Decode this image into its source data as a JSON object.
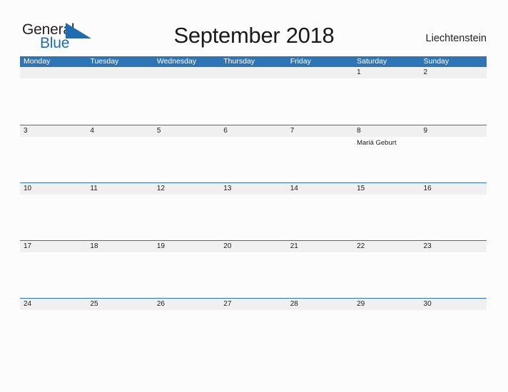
{
  "logo": {
    "word_one": "General",
    "word_two": "Blue",
    "triangle_icon": "blue-triangle-icon",
    "black_color": "#231f20",
    "blue_color": "#1f6cb0"
  },
  "header": {
    "title": "September 2018",
    "country": "Liechtenstein"
  },
  "theme": {
    "header_bar_color": "#2e75b6",
    "date_band_color": "#f0f0f0",
    "rule_color": "#2e75b6",
    "page_background": "#fcfcfc",
    "text_color": "#1a1a1a"
  },
  "calendar": {
    "month": "September",
    "year": "2018",
    "weekdays": [
      "Monday",
      "Tuesday",
      "Wednesday",
      "Thursday",
      "Friday",
      "Saturday",
      "Sunday"
    ],
    "weeks": [
      {
        "has_rule": false,
        "days": [
          {
            "date": "",
            "event": ""
          },
          {
            "date": "",
            "event": ""
          },
          {
            "date": "",
            "event": ""
          },
          {
            "date": "",
            "event": ""
          },
          {
            "date": "",
            "event": ""
          },
          {
            "date": "1",
            "event": ""
          },
          {
            "date": "2",
            "event": ""
          }
        ]
      },
      {
        "has_rule": true,
        "days": [
          {
            "date": "3",
            "event": ""
          },
          {
            "date": "4",
            "event": ""
          },
          {
            "date": "5",
            "event": ""
          },
          {
            "date": "6",
            "event": ""
          },
          {
            "date": "7",
            "event": ""
          },
          {
            "date": "8",
            "event": "Mariä Geburt"
          },
          {
            "date": "9",
            "event": ""
          }
        ]
      },
      {
        "has_rule": true,
        "days": [
          {
            "date": "10",
            "event": ""
          },
          {
            "date": "11",
            "event": ""
          },
          {
            "date": "12",
            "event": ""
          },
          {
            "date": "13",
            "event": ""
          },
          {
            "date": "14",
            "event": ""
          },
          {
            "date": "15",
            "event": ""
          },
          {
            "date": "16",
            "event": ""
          }
        ]
      },
      {
        "has_rule": true,
        "days": [
          {
            "date": "17",
            "event": ""
          },
          {
            "date": "18",
            "event": ""
          },
          {
            "date": "19",
            "event": ""
          },
          {
            "date": "20",
            "event": ""
          },
          {
            "date": "21",
            "event": ""
          },
          {
            "date": "22",
            "event": ""
          },
          {
            "date": "23",
            "event": ""
          }
        ]
      },
      {
        "has_rule": true,
        "days": [
          {
            "date": "24",
            "event": ""
          },
          {
            "date": "25",
            "event": ""
          },
          {
            "date": "26",
            "event": ""
          },
          {
            "date": "27",
            "event": ""
          },
          {
            "date": "28",
            "event": ""
          },
          {
            "date": "29",
            "event": ""
          },
          {
            "date": "30",
            "event": ""
          }
        ]
      }
    ]
  }
}
